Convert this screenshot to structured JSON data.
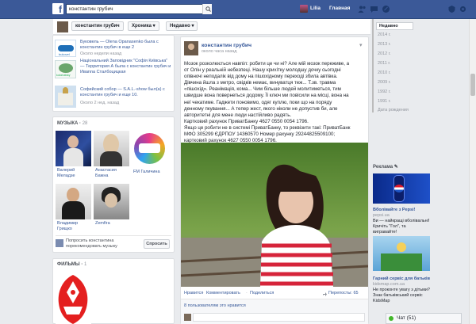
{
  "topbar": {
    "logo": "f",
    "search_value": "константин грубич",
    "user_name": "Lilia",
    "home_label": "Главная"
  },
  "subbar": {
    "name_crumb": "константин грубич",
    "chronicle_crumb": "Хроника",
    "recent_crumb": "Недавно"
  },
  "timeline": {
    "selected": "Недавно",
    "years": [
      "2014 г.",
      "2013 г.",
      "2012 г.",
      "2011 г.",
      "2010 г.",
      "2009 г.",
      "1992 г.",
      "1991 г."
    ],
    "birth": "Дата рождения"
  },
  "places": [
    {
      "title": "Буковель — Olena Opanasenko была с константин грубич в еще 2",
      "time": "Около недели назад",
      "thumb": "bukovel"
    },
    {
      "title": "Національний Заповідник \"Софія Київська\" — Территория А была с константин грубич и Ивanna Сталбоцицкая",
      "time": "",
      "thumb": "kolomatsky"
    },
    {
      "title": "Софийский собор — S.A.L.-show был(а) с константин грубич и еще 10.",
      "time": "Около 2 нед. назад",
      "thumb": "sofia"
    }
  ],
  "music": {
    "header": "МУЗЫКА",
    "items": [
      {
        "name": "Валерий Меладзе"
      },
      {
        "name": "Анастасия Бажна"
      },
      {
        "name": "FM Галичина"
      },
      {
        "name": "Владимир Грищко"
      },
      {
        "name": "Zemfira"
      }
    ],
    "suggest_text": "Попросить константина порекомендовать музыку",
    "suggest_button": "Спросить"
  },
  "films": {
    "header": "ФИЛЬМЫ",
    "count": "1"
  },
  "post": {
    "author": "константин грубич",
    "time": "около часа назад",
    "lines": [
      "Мозок розколюється навпіл: робити це чи ні? Але мій мозок переживе, а",
      "от Олін у реальній небезпеці. Нашу крихітку молодшу дочку сьогодні",
      "опівночі неподалік від дому на пішохідному переході збила автівка.",
      "Дівчина йшла з метро, свідків немає, винуватця теж... Т.зв. травма",
      "«пішохід». Реанімація, кома... Чим більше людей молитиметься, тим",
      "швидше вона повернеться додому. Її ключ ми повісили на місці, вона на",
      "неї чекатиме. Гаджети поновимо, одяг куплю, поки що на поряду",
      "денному пкування... А тепер жест, якого ніколи не допустив би, але",
      "авторитетні для мене люди настійливо радять.",
      "Картковий рахунок ПриватБанку 4627 0550 0054 1796.",
      "Якщо це робити не в системі ПриватБанку, то реквізити такі: ПриватБанк",
      "МФО 305299 ЄДРПОУ 14360570 Номер рахунку 29244825509100;",
      "картковий рахунок 4627 0550 0054 1796."
    ],
    "like": "Нравится",
    "comment": "Комментировать",
    "share": "Поделиться",
    "reposts": "Перепосты: 65",
    "likes_summary": "8 пользователям это нравится"
  },
  "ads": {
    "header": "Реклама",
    "ad1": {
      "title": "Вболівайте з Pepsi!",
      "domain": "pepsi.ua",
      "text": "Ви — найкращі вболівальні! Кричіть \"Гол\", та вигравайте!"
    },
    "ad2": {
      "title": "Гарний сервіс для батьків",
      "domain": "kidsmap.com.ua",
      "text": "Не проконте увагу з дітьми? Знак батьківський сервіс KidsMap"
    }
  },
  "chat": {
    "label": "Чат (51)"
  },
  "colors": {
    "brand": "#3b5998",
    "link": "#365899",
    "bg": "#e9ebee"
  }
}
